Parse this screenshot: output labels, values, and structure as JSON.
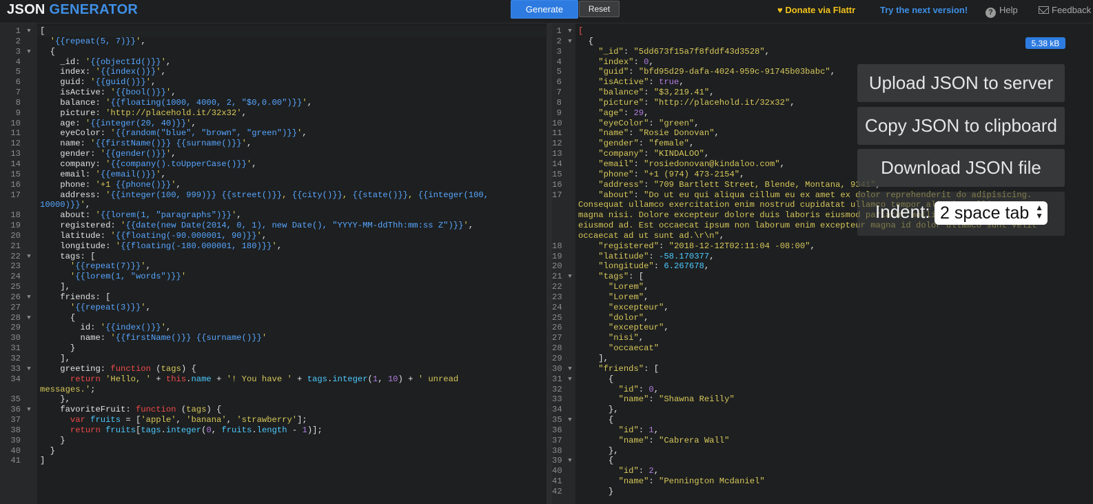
{
  "header": {
    "logo_part1": "JSON",
    "logo_part2": "GENERATOR",
    "generate_label": "Generate",
    "reset_label": "Reset",
    "donate_label": "Donate via Flattr",
    "donate_icon": "heart-icon",
    "next_version_label": "Try the next version!",
    "help_label": "Help",
    "help_icon": "question-circle-icon",
    "feedback_label": "Feedback",
    "feedback_icon": "envelope-icon"
  },
  "output_panel": {
    "size_badge": "5.38 kB",
    "upload_label": "Upload JSON to server",
    "copy_label": "Copy JSON to clipboard",
    "download_label": "Download JSON file",
    "indent_label": "Indent:",
    "indent_value": "2 space tab"
  },
  "template_lines": [
    {
      "n": "1",
      "f": true,
      "h": "<span class=\"br\">[</span>"
    },
    {
      "n": "2",
      "f": false,
      "h": "  <span class=\"s\">'</span><span class=\"t\">{{repeat(5, 7)}}</span><span class=\"s\">'</span><span class=\"br\">,</span>"
    },
    {
      "n": "3",
      "f": true,
      "h": "  <span class=\"br\">{</span>"
    },
    {
      "n": "4",
      "f": false,
      "h": "    <span class=\"k\">_id</span>: <span class=\"s\">'</span><span class=\"t\">{{objectId()}}</span><span class=\"s\">'</span>,"
    },
    {
      "n": "5",
      "f": false,
      "h": "    <span class=\"k\">index</span>: <span class=\"s\">'</span><span class=\"t\">{{index()}}</span><span class=\"s\">'</span>,"
    },
    {
      "n": "6",
      "f": false,
      "h": "    <span class=\"k\">guid</span>: <span class=\"s\">'</span><span class=\"t\">{{guid()}}</span><span class=\"s\">'</span>,"
    },
    {
      "n": "7",
      "f": false,
      "h": "    <span class=\"k\">isActive</span>: <span class=\"s\">'</span><span class=\"t\">{{bool()}}</span><span class=\"s\">'</span>,"
    },
    {
      "n": "8",
      "f": false,
      "h": "    <span class=\"k\">balance</span>: <span class=\"s\">'</span><span class=\"t\">{{floating(1000, 4000, 2, \"$0,0.00\")}}</span><span class=\"s\">'</span>,"
    },
    {
      "n": "9",
      "f": false,
      "h": "    <span class=\"k\">picture</span>: <span class=\"s\">'http://placehold.it/32x32'</span>,"
    },
    {
      "n": "10",
      "f": false,
      "h": "    <span class=\"k\">age</span>: <span class=\"s\">'</span><span class=\"t\">{{integer(20, 40)}}</span><span class=\"s\">'</span>,"
    },
    {
      "n": "11",
      "f": false,
      "h": "    <span class=\"k\">eyeColor</span>: <span class=\"s\">'</span><span class=\"t\">{{random(\"blue\", \"brown\", \"green\")}}</span><span class=\"s\">'</span>,"
    },
    {
      "n": "12",
      "f": false,
      "h": "    <span class=\"k\">name</span>: <span class=\"s\">'</span><span class=\"t\">{{firstName()}}</span> <span class=\"t\">{{surname()}}</span><span class=\"s\">'</span>,"
    },
    {
      "n": "13",
      "f": false,
      "h": "    <span class=\"k\">gender</span>: <span class=\"s\">'</span><span class=\"t\">{{gender()}}</span><span class=\"s\">'</span>,"
    },
    {
      "n": "14",
      "f": false,
      "h": "    <span class=\"k\">company</span>: <span class=\"s\">'</span><span class=\"t\">{{company().toUpperCase()}}</span><span class=\"s\">'</span>,"
    },
    {
      "n": "15",
      "f": false,
      "h": "    <span class=\"k\">email</span>: <span class=\"s\">'</span><span class=\"t\">{{email()}}</span><span class=\"s\">'</span>,"
    },
    {
      "n": "16",
      "f": false,
      "h": "    <span class=\"k\">phone</span>: <span class=\"s\">'+1 </span><span class=\"t\">{{phone()}}</span><span class=\"s\">'</span>,"
    },
    {
      "n": "17",
      "f": false,
      "h": "    <span class=\"k\">address</span>: <span class=\"s\">'</span><span class=\"t\">{{integer(100, 999)}}</span> <span class=\"t\">{{street()}}</span><span class=\"s\">, </span><span class=\"t\">{{city()}}</span><span class=\"s\">, </span><span class=\"t\">{{state()}}</span><span class=\"s\">, </span><span class=\"t\">{{integer(100,</span>"
    },
    {
      "n": "",
      "f": false,
      "w": true,
      "h": "<span class=\"t\">10000)}}</span><span class=\"s\">'</span>,"
    },
    {
      "n": "18",
      "f": false,
      "h": "    <span class=\"k\">about</span>: <span class=\"s\">'</span><span class=\"t\">{{lorem(1, \"paragraphs\")}}</span><span class=\"s\">'</span>,"
    },
    {
      "n": "19",
      "f": false,
      "h": "    <span class=\"k\">registered</span>: <span class=\"s\">'</span><span class=\"t\">{{date(new Date(2014, 0, 1), new Date(), \"YYYY-MM-ddThh:mm:ss Z\")}}</span><span class=\"s\">'</span>,"
    },
    {
      "n": "20",
      "f": false,
      "h": "    <span class=\"k\">latitude</span>: <span class=\"s\">'</span><span class=\"t\">{{floating(-90.000001, 90)}}</span><span class=\"s\">'</span>,"
    },
    {
      "n": "21",
      "f": false,
      "h": "    <span class=\"k\">longitude</span>: <span class=\"s\">'</span><span class=\"t\">{{floating(-180.000001, 180)}}</span><span class=\"s\">'</span>,"
    },
    {
      "n": "22",
      "f": true,
      "h": "    <span class=\"k\">tags</span>: ["
    },
    {
      "n": "23",
      "f": false,
      "h": "      <span class=\"s\">'</span><span class=\"t\">{{repeat(7)}}</span><span class=\"s\">'</span>,"
    },
    {
      "n": "24",
      "f": false,
      "h": "      <span class=\"s\">'</span><span class=\"t\">{{lorem(1, \"words\")}}</span><span class=\"s\">'</span>"
    },
    {
      "n": "25",
      "f": false,
      "h": "    ],"
    },
    {
      "n": "26",
      "f": true,
      "h": "    <span class=\"k\">friends</span>: ["
    },
    {
      "n": "27",
      "f": false,
      "h": "      <span class=\"s\">'</span><span class=\"t\">{{repeat(3)}}</span><span class=\"s\">'</span>,"
    },
    {
      "n": "28",
      "f": true,
      "h": "      {"
    },
    {
      "n": "29",
      "f": false,
      "h": "        <span class=\"k\">id</span>: <span class=\"s\">'</span><span class=\"t\">{{index()}}</span><span class=\"s\">'</span>,"
    },
    {
      "n": "30",
      "f": false,
      "h": "        <span class=\"k\">name</span>: <span class=\"s\">'</span><span class=\"t\">{{firstName()}}</span> <span class=\"t\">{{surname()}}</span><span class=\"s\">'</span>"
    },
    {
      "n": "31",
      "f": false,
      "h": "      }"
    },
    {
      "n": "32",
      "f": false,
      "h": "    ],"
    },
    {
      "n": "33",
      "f": true,
      "h": "    <span class=\"k\">greeting</span>: <span class=\"kw\">function</span> (<span class=\"s\">tags</span>) {"
    },
    {
      "n": "34",
      "f": false,
      "h": "      <span class=\"kw\">return</span> <span class=\"s\">'Hello, '</span> + <span class=\"kw\">this</span>.<span class=\"fn\">name</span> + <span class=\"s\">'! You have '</span> + <span class=\"fn\">tags</span>.<span class=\"fn\">integer</span>(<span class=\"n\">1</span>, <span class=\"n\">10</span>) + <span class=\"s\">' unread</span>"
    },
    {
      "n": "",
      "f": false,
      "w": true,
      "h": "<span class=\"s\">messages.'</span>;"
    },
    {
      "n": "35",
      "f": false,
      "h": "    },"
    },
    {
      "n": "36",
      "f": true,
      "h": "    <span class=\"k\">favoriteFruit</span>: <span class=\"kw\">function</span> (<span class=\"s\">tags</span>) {"
    },
    {
      "n": "37",
      "f": false,
      "h": "      <span class=\"kw\">var</span> <span class=\"fn\">fruits</span> = [<span class=\"s\">'apple'</span>, <span class=\"s\">'banana'</span>, <span class=\"s\">'strawberry'</span>];"
    },
    {
      "n": "38",
      "f": false,
      "h": "      <span class=\"kw\">return</span> <span class=\"fn\">fruits</span>[<span class=\"fn\">tags</span>.<span class=\"fn\">integer</span>(<span class=\"n\">0</span>, <span class=\"fn\">fruits</span>.<span class=\"fn\">length</span> - <span class=\"n\">1</span>)];"
    },
    {
      "n": "39",
      "f": false,
      "h": "    }"
    },
    {
      "n": "40",
      "f": false,
      "h": "  }"
    },
    {
      "n": "41",
      "f": false,
      "h": "]"
    }
  ],
  "output_lines": [
    {
      "n": "1",
      "f": true,
      "h": "<span class=\"red\">[</span>"
    },
    {
      "n": "2",
      "f": true,
      "h": "  {"
    },
    {
      "n": "3",
      "f": false,
      "h": "    <span class=\"jk\">\"_id\"</span>: <span class=\"jv\">\"5dd673f15a7f8fddf43d3528\"</span>,"
    },
    {
      "n": "4",
      "f": false,
      "h": "    <span class=\"jk\">\"index\"</span>: <span class=\"jn\">0</span>,"
    },
    {
      "n": "5",
      "f": false,
      "h": "    <span class=\"jk\">\"guid\"</span>: <span class=\"jv\">\"bfd95d29-dafa-4024-959c-91745b03babc\"</span>,"
    },
    {
      "n": "6",
      "f": false,
      "h": "    <span class=\"jk\">\"isActive\"</span>: <span class=\"jb\">true</span>,"
    },
    {
      "n": "7",
      "f": false,
      "h": "    <span class=\"jk\">\"balance\"</span>: <span class=\"jv\">\"$3,219.41\"</span>,"
    },
    {
      "n": "8",
      "f": false,
      "h": "    <span class=\"jk\">\"picture\"</span>: <span class=\"jv\">\"http://placehold.it/32x32\"</span>,"
    },
    {
      "n": "9",
      "f": false,
      "h": "    <span class=\"jk\">\"age\"</span>: <span class=\"jn\">29</span>,"
    },
    {
      "n": "10",
      "f": false,
      "h": "    <span class=\"jk\">\"eyeColor\"</span>: <span class=\"jv\">\"green\"</span>,"
    },
    {
      "n": "11",
      "f": false,
      "h": "    <span class=\"jk\">\"name\"</span>: <span class=\"jv\">\"Rosie Donovan\"</span>,"
    },
    {
      "n": "12",
      "f": false,
      "h": "    <span class=\"jk\">\"gender\"</span>: <span class=\"jv\">\"female\"</span>,"
    },
    {
      "n": "13",
      "f": false,
      "h": "    <span class=\"jk\">\"company\"</span>: <span class=\"jv\">\"KINDALOO\"</span>,"
    },
    {
      "n": "14",
      "f": false,
      "h": "    <span class=\"jk\">\"email\"</span>: <span class=\"jv\">\"rosiedonovan@kindaloo.com\"</span>,"
    },
    {
      "n": "15",
      "f": false,
      "h": "    <span class=\"jk\">\"phone\"</span>: <span class=\"jv\">\"+1 (974) 473-2154\"</span>,"
    },
    {
      "n": "16",
      "f": false,
      "h": "    <span class=\"jk\">\"address\"</span>: <span class=\"jv\">\"709 Bartlett Street, Blende, Montana, 9341\"</span>,"
    },
    {
      "n": "17",
      "f": false,
      "h": "    <span class=\"jk\">\"about\"</span>: <span class=\"jv\">\"Do ut eu qui aliqua cillum eu ex amet ex dolor reprehenderit do adipisicing.</span>"
    },
    {
      "n": "",
      "f": false,
      "w": true,
      "h": "<span class=\"jv\">Consequat ullamco exercitation enim nostrud cupidatat ullamco tempor aliquip mollit sunt</span>"
    },
    {
      "n": "",
      "f": false,
      "w": true,
      "h": "<span class=\"jv\">magna nisi. Dolore excepteur dolore duis laboris eiusmod pariatur mollit fugiat est</span>"
    },
    {
      "n": "",
      "f": false,
      "w": true,
      "h": "<span class=\"jv\">eiusmod ad. Est occaecat ipsum non laborum enim excepteur magna id dolor ullamco sunt velit</span>"
    },
    {
      "n": "",
      "f": false,
      "w": true,
      "h": "<span class=\"jv\">occaecat ad ut sunt ad.\\r\\n\"</span>,"
    },
    {
      "n": "18",
      "f": false,
      "h": "    <span class=\"jk\">\"registered\"</span>: <span class=\"jv\">\"2018-12-12T02:11:04 -08:00\"</span>,"
    },
    {
      "n": "19",
      "f": false,
      "h": "    <span class=\"jk\">\"latitude\"</span>: <span class=\"jnum\">-58.170377</span>,"
    },
    {
      "n": "20",
      "f": false,
      "h": "    <span class=\"jk\">\"longitude\"</span>: <span class=\"jnum\">6.267678</span>,"
    },
    {
      "n": "21",
      "f": true,
      "h": "    <span class=\"jk\">\"tags\"</span>: ["
    },
    {
      "n": "22",
      "f": false,
      "h": "      <span class=\"jv\">\"Lorem\"</span>,"
    },
    {
      "n": "23",
      "f": false,
      "h": "      <span class=\"jv\">\"Lorem\"</span>,"
    },
    {
      "n": "24",
      "f": false,
      "h": "      <span class=\"jv\">\"excepteur\"</span>,"
    },
    {
      "n": "25",
      "f": false,
      "h": "      <span class=\"jv\">\"dolor\"</span>,"
    },
    {
      "n": "26",
      "f": false,
      "h": "      <span class=\"jv\">\"excepteur\"</span>,"
    },
    {
      "n": "27",
      "f": false,
      "h": "      <span class=\"jv\">\"nisi\"</span>,"
    },
    {
      "n": "28",
      "f": false,
      "h": "      <span class=\"jv\">\"occaecat\"</span>"
    },
    {
      "n": "29",
      "f": false,
      "h": "    ],"
    },
    {
      "n": "30",
      "f": true,
      "h": "    <span class=\"jk\">\"friends\"</span>: ["
    },
    {
      "n": "31",
      "f": true,
      "h": "      {"
    },
    {
      "n": "32",
      "f": false,
      "h": "        <span class=\"jk\">\"id\"</span>: <span class=\"jn\">0</span>,"
    },
    {
      "n": "33",
      "f": false,
      "h": "        <span class=\"jk\">\"name\"</span>: <span class=\"jv\">\"Shawna Reilly\"</span>"
    },
    {
      "n": "34",
      "f": false,
      "h": "      },"
    },
    {
      "n": "35",
      "f": true,
      "h": "      {"
    },
    {
      "n": "36",
      "f": false,
      "h": "        <span class=\"jk\">\"id\"</span>: <span class=\"jn\">1</span>,"
    },
    {
      "n": "37",
      "f": false,
      "h": "        <span class=\"jk\">\"name\"</span>: <span class=\"jv\">\"Cabrera Wall\"</span>"
    },
    {
      "n": "38",
      "f": false,
      "h": "      },"
    },
    {
      "n": "39",
      "f": true,
      "h": "      {"
    },
    {
      "n": "40",
      "f": false,
      "h": "        <span class=\"jk\">\"id\"</span>: <span class=\"jn\">2</span>,"
    },
    {
      "n": "41",
      "f": false,
      "h": "        <span class=\"jk\">\"name\"</span>: <span class=\"jv\">\"Pennington Mcdaniel\"</span>"
    },
    {
      "n": "42",
      "f": false,
      "h": "      }"
    }
  ]
}
